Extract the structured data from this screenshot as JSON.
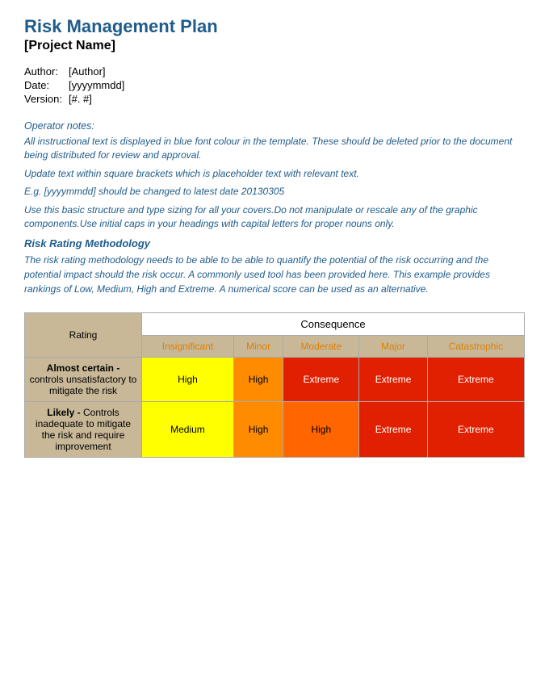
{
  "header": {
    "title": "Risk Management Plan",
    "project_name": "[Project Name]"
  },
  "meta": {
    "author_label": "Author:",
    "author_value": "[Author]",
    "date_label": "Date:",
    "date_value": "[yyyymmdd]",
    "version_label": "Version:",
    "version_value": "[#. #]"
  },
  "operator": {
    "label": "Operator notes:",
    "line1": "All instructional text is displayed in blue font colour in the template. These should be deleted prior to the document being distributed for review and approval.",
    "line2": "Update text within square brackets which is placeholder text with relevant text.",
    "line3": "E.g. [yyyymmdd] should be changed to latest date 20130305",
    "line4": "Use this basic structure and type sizing for all your covers.Do not manipulate or rescale any of the graphic components.Use initial caps in your headings with capital letters for proper nouns only."
  },
  "risk_rating": {
    "heading": "Risk Rating Methodology",
    "text": "The risk rating methodology needs to be able to be able to quantify the potential of the risk occurring and the potential impact should the risk occur.  A commonly used tool has been provided here.  This example provides rankings of Low, Medium, High and Extreme.  A numerical score can be used as an alternative."
  },
  "matrix": {
    "consequence_label": "Consequence",
    "rating_label": "Rating",
    "columns": [
      "Insignificant",
      "Minor",
      "Moderate",
      "Major",
      "Catastrophic"
    ],
    "rows": [
      {
        "label_bold": "Almost certain -",
        "label_text": " controls unsatisfactory to mitigate the risk",
        "cells": [
          "High",
          "High",
          "Extreme",
          "Extreme",
          "Extreme"
        ],
        "cell_types": [
          "high-yellow",
          "high-orange",
          "extreme",
          "extreme",
          "extreme"
        ]
      },
      {
        "label_bold": "Likely -",
        "label_text": " Controls inadequate to mitigate the risk and require improvement",
        "cells": [
          "Medium",
          "High",
          "High",
          "Extreme",
          "Extreme"
        ],
        "cell_types": [
          "medium",
          "high-orange2",
          "high-red",
          "extreme",
          "extreme"
        ]
      }
    ]
  }
}
